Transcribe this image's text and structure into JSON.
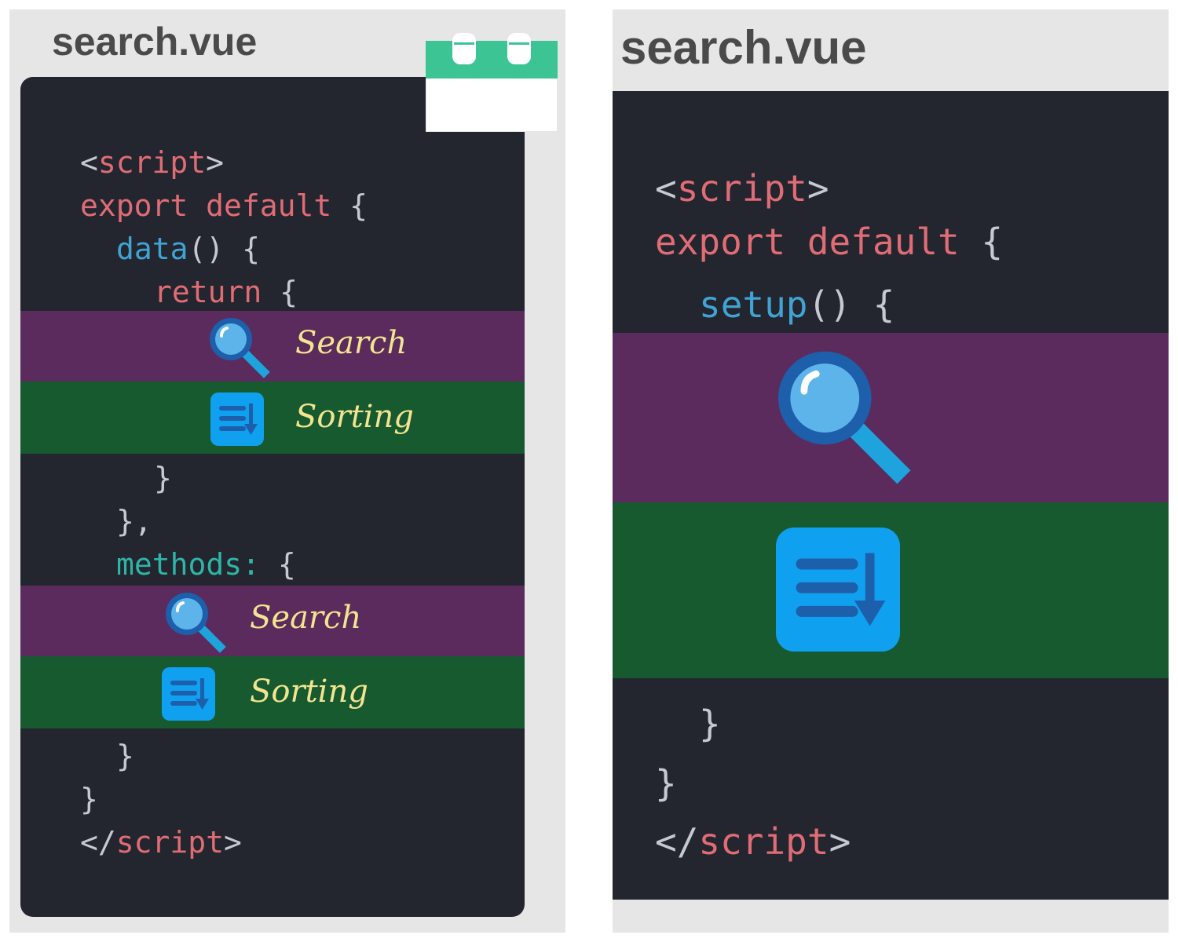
{
  "left": {
    "filename": "search.vue",
    "code": {
      "open_tag_lt": "<",
      "open_tag_name": "script",
      "open_tag_gt": ">",
      "export_kw": "export default",
      "export_brace": " {",
      "data_fn": "data",
      "data_rest": "() {",
      "return_kw": "return",
      "return_brace": " {",
      "close_return": "}",
      "close_data": "},",
      "methods_kw": "methods:",
      "methods_brace": " {",
      "close_methods": "}",
      "close_export": "}",
      "close_tag_lt": "</",
      "close_tag_name": "script",
      "close_tag_gt": ">"
    },
    "bands": [
      {
        "label": "Search",
        "icon": "magnifier-icon",
        "color": "#5b2b5e"
      },
      {
        "label": "Sorting",
        "icon": "sort-list-icon",
        "color": "#175a30"
      },
      {
        "label": "Search",
        "icon": "magnifier-icon",
        "color": "#5b2b5e"
      },
      {
        "label": "Sorting",
        "icon": "sort-list-icon",
        "color": "#175a30"
      }
    ]
  },
  "right": {
    "filename": "search.vue",
    "code": {
      "open_tag_lt": "<",
      "open_tag_name": "script",
      "open_tag_gt": ">",
      "export_kw": "export default",
      "export_brace": " {",
      "setup_fn": "setup",
      "setup_rest": "() {",
      "close_setup": "}",
      "close_export": "}",
      "close_tag_lt": "</",
      "close_tag_name": "script",
      "close_tag_gt": ">"
    },
    "bands": [
      {
        "icon": "magnifier-icon",
        "color": "#5b2b5e"
      },
      {
        "icon": "sort-list-icon",
        "color": "#175a30"
      }
    ]
  },
  "colors": {
    "editor_bg": "#23252f",
    "panel_bg": "#e6e6e6",
    "keyword": "#e06c75",
    "function": "#3fa4d4",
    "property": "#2fb4a6",
    "label": "#f3e58f",
    "calendar_green": "#3cc494"
  }
}
